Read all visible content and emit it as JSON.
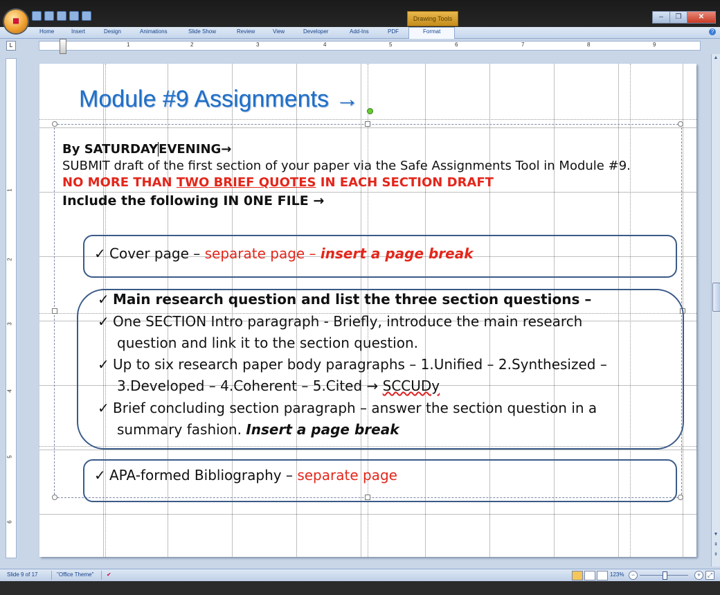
{
  "ribbon": {
    "tabs": [
      "Home",
      "Insert",
      "Design",
      "Animations",
      "Slide Show",
      "Review",
      "View",
      "Developer",
      "Add-Ins",
      "PDF",
      "Format"
    ],
    "contextual_tab": "Drawing Tools",
    "active_tab": "Format"
  },
  "ruler": {
    "h_numbers": [
      "1",
      "2",
      "3",
      "4",
      "5",
      "6",
      "7",
      "8",
      "9"
    ],
    "v_numbers": [
      "1",
      "2",
      "3",
      "4",
      "5",
      "6"
    ],
    "tab_selector": "L"
  },
  "slide": {
    "title": "Module #9 Assignments →",
    "intro": {
      "line1_a": "By SATURDAY",
      "line1_b": "EVENING→",
      "line2": "SUBMIT draft of the first section of your paper via the Safe Assignments Tool in Module #9.",
      "line3_a": "NO MORE THAN ",
      "line3_b": "TWO BRIEF QUOTES",
      "line3_c": " IN EACH SECTION DRAFT",
      "line4": "Include the following IN 0NE FILE →"
    },
    "box1": {
      "check": "✓",
      "text_a": "Cover page – ",
      "text_b": "separate page – ",
      "text_c": "insert a page break"
    },
    "box2": {
      "check": "✓",
      "item1": "Main research question and list the three section questions –",
      "item2_l1": "One SECTION Intro paragraph  - Briefly, introduce the main research",
      "item2_l2": "question and link it to the section question.",
      "item3_l1": "Up to six research paper body paragraphs – 1.Unified – 2.Synthesized –",
      "item3_l2_a": "3.Developed – 4.Coherent – 5.Cited → ",
      "item3_l2_b": "SCCUDy",
      "item4_l1": "Brief concluding section paragraph – answer the section question in a",
      "item4_l2_a": "summary fashion.  ",
      "item4_l2_b": "Insert a page break"
    },
    "box3": {
      "check": "✓",
      "text_a": "APA-formed Bibliography – ",
      "text_b": "separate page"
    }
  },
  "status": {
    "slide_count": "Slide 9 of 17",
    "theme": "\"Office Theme\"",
    "zoom": "123%",
    "zoom_level_percent": 123
  },
  "colors": {
    "title_blue": "#1f6fc7",
    "accent_red": "#e3261b",
    "box_border": "#3a5a88"
  }
}
